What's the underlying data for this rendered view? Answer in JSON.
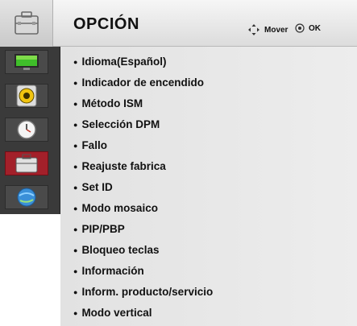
{
  "header": {
    "title": "OPCIÓN",
    "move_label": "Mover",
    "ok_label": "OK"
  },
  "sidebar": {
    "items": [
      {
        "icon": "picture-icon"
      },
      {
        "icon": "audio-icon"
      },
      {
        "icon": "time-icon"
      },
      {
        "icon": "option-icon",
        "active": true
      },
      {
        "icon": "network-icon"
      }
    ]
  },
  "menu": {
    "items": [
      "Idioma(Español)",
      "Indicador de encendido",
      "Método ISM",
      "Selección DPM",
      "Fallo",
      "Reajuste fabrica",
      "Set ID",
      "Modo mosaico",
      "PIP/PBP",
      "Bloqueo teclas",
      "Información",
      "Inform. producto/servicio",
      "Modo vertical"
    ]
  },
  "colors": {
    "active": "#a3202a",
    "sidebar": "#3a3a3a",
    "panel": "#e6e6e6"
  }
}
